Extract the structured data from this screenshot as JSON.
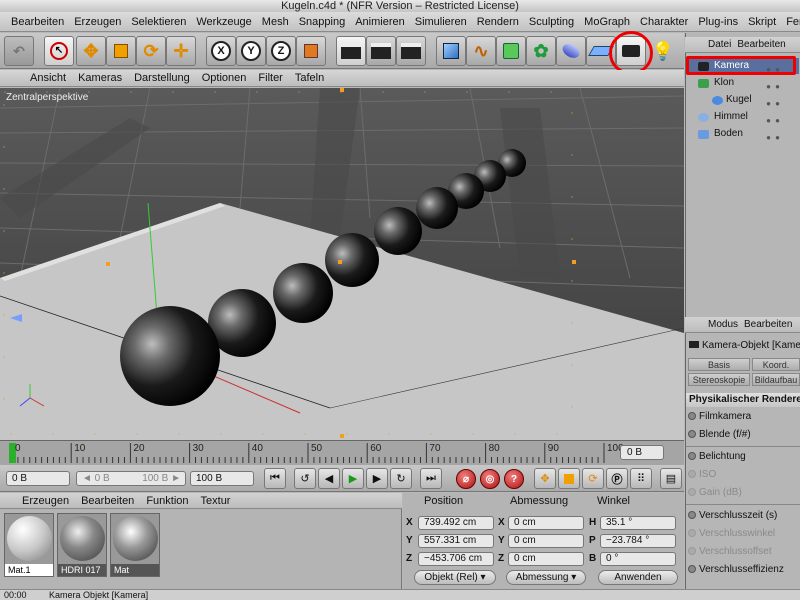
{
  "window": {
    "title": "Kugeln.c4d * (NFR Version – Restricted License)"
  },
  "menubar": [
    "Bearbeiten",
    "Erzeugen",
    "Selektieren",
    "Werkzeuge",
    "Mesh",
    "Snapping",
    "Animieren",
    "Simulieren",
    "Rendern",
    "Sculpting",
    "MoGraph",
    "Charakter",
    "Plug-ins",
    "Skript",
    "Fenster"
  ],
  "toolbar": {
    "axis_x": "X",
    "axis_y": "Y",
    "axis_z": "Z"
  },
  "viewport": {
    "menu": [
      "Ansicht",
      "Kameras",
      "Darstellung",
      "Optionen",
      "Filter",
      "Tafeln"
    ],
    "label": "Zentralperspektive"
  },
  "timeline": {
    "ticks": [
      "0",
      "10",
      "20",
      "30",
      "40",
      "50",
      "60",
      "70",
      "80",
      "90",
      "100"
    ],
    "current_frame": "0 B"
  },
  "transport": {
    "start_field": "0 B",
    "range_left": "◄ 0 B",
    "range_right": "100 B ►",
    "end_field": "100 B"
  },
  "materials": {
    "menu": [
      "Erzeugen",
      "Bearbeiten",
      "Funktion",
      "Textur"
    ],
    "items": [
      {
        "name": "Mat.1"
      },
      {
        "name": "HDRI 017"
      },
      {
        "name": "Mat"
      }
    ]
  },
  "coordinates": {
    "headers": {
      "position": "Position",
      "size": "Abmessung",
      "rotation": "Winkel"
    },
    "rows": [
      {
        "axis": "X",
        "pos": "739.492 cm",
        "size_axis": "X",
        "size": "0 cm",
        "rot_axis": "H",
        "rot": "35.1 °"
      },
      {
        "axis": "Y",
        "pos": "557.331 cm",
        "size_axis": "Y",
        "size": "0 cm",
        "rot_axis": "P",
        "rot": "−23.784 °"
      },
      {
        "axis": "Z",
        "pos": "−453.706 cm",
        "size_axis": "Z",
        "size": "0 cm",
        "rot_axis": "B",
        "rot": "0 °"
      }
    ],
    "mode_select": "Objekt (Rel)",
    "size_select": "Abmessung",
    "apply_button": "Anwenden"
  },
  "objects": {
    "menu": [
      "Datei",
      "Bearbeiten"
    ],
    "items": [
      {
        "name": "Kamera",
        "selected": true,
        "indent": 0
      },
      {
        "name": "Klon",
        "selected": false,
        "indent": 0
      },
      {
        "name": "Kugel",
        "selected": false,
        "indent": 1
      },
      {
        "name": "Himmel",
        "selected": false,
        "indent": 0
      },
      {
        "name": "Boden",
        "selected": false,
        "indent": 0
      }
    ]
  },
  "attributes": {
    "menu": [
      "Modus",
      "Bearbeiten"
    ],
    "object_title": "Kamera-Objekt [Kamera]",
    "tabs": [
      "Basis",
      "Koord.",
      "Stereoskopie",
      "Bildaufbau"
    ],
    "section": "Physikalischer Renderer",
    "rows": [
      {
        "label": "Filmkamera",
        "enabled": true
      },
      {
        "label": "Blende (f/#)",
        "enabled": true
      },
      {
        "label": "Belichtung",
        "enabled": true
      },
      {
        "label": "ISO",
        "enabled": false
      },
      {
        "label": "Gain (dB)",
        "enabled": false
      },
      {
        "label": "Verschlusszeit (s)",
        "enabled": true
      },
      {
        "label": "Verschlusswinkel",
        "enabled": false
      },
      {
        "label": "Verschlussoffset",
        "enabled": false
      },
      {
        "label": "Verschlusseffizienz",
        "enabled": true
      }
    ]
  },
  "status": {
    "time": "00:00",
    "text": "Kamera Objekt [Kamera]"
  },
  "colors": {
    "accent_red": "#e00000",
    "selection": "#5a6f9e"
  }
}
